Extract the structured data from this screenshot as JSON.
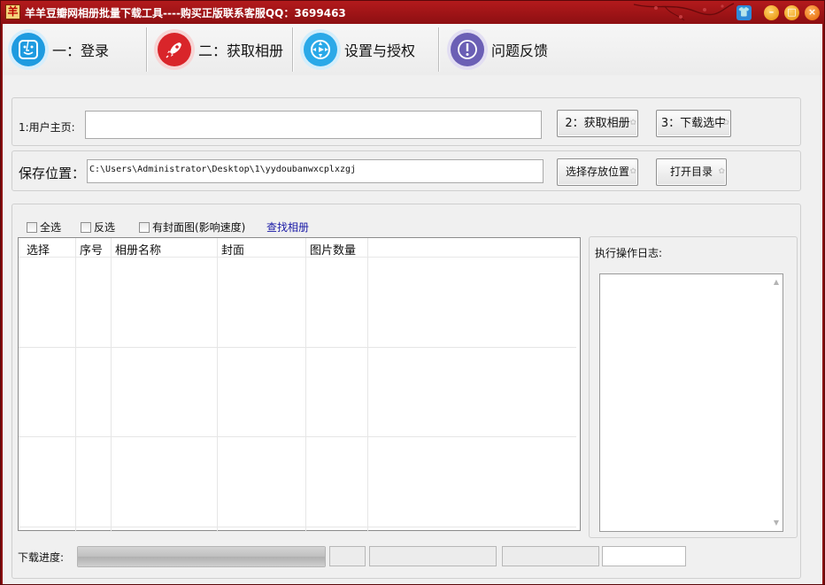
{
  "window": {
    "title": "羊羊豆瓣网相册批量下载工具----购买正版联系客服QQ：3699463",
    "app_icon_char": "羊"
  },
  "toolbar": {
    "items": [
      {
        "label": "一：登录",
        "icon": "finder-face-icon",
        "color": "#1e9be0"
      },
      {
        "label": "二：获取相册",
        "icon": "rocket-icon",
        "color": "#d9252a"
      },
      {
        "label": "设置与授权",
        "icon": "settings-dial-icon",
        "color": "#2aa9e8"
      },
      {
        "label": "问题反馈",
        "icon": "exclamation-icon",
        "color": "#6b5fb5"
      }
    ]
  },
  "form": {
    "homepage_label": "1:用户主页:",
    "homepage_value": "",
    "get_album_button": "2：获取相册",
    "download_selected_button": "3：下载选中",
    "save_location_label": "保存位置：",
    "save_location_value": "C:\\Users\\Administrator\\Desktop\\1\\yydoubanwxcplxzgj",
    "choose_location_button": "选择存放位置",
    "open_dir_button": "打开目录"
  },
  "options": {
    "select_all": "全选",
    "invert_select": "反选",
    "with_cover": "有封面图(影响速度)",
    "find_album_link": "查找相册"
  },
  "grid": {
    "columns": [
      "选择",
      "序号",
      "相册名称",
      "封面",
      "图片数量"
    ],
    "rows": []
  },
  "log": {
    "label": "执行操作日志:",
    "content": ""
  },
  "status": {
    "progress_label": "下载进度:",
    "progress": 1.0
  }
}
